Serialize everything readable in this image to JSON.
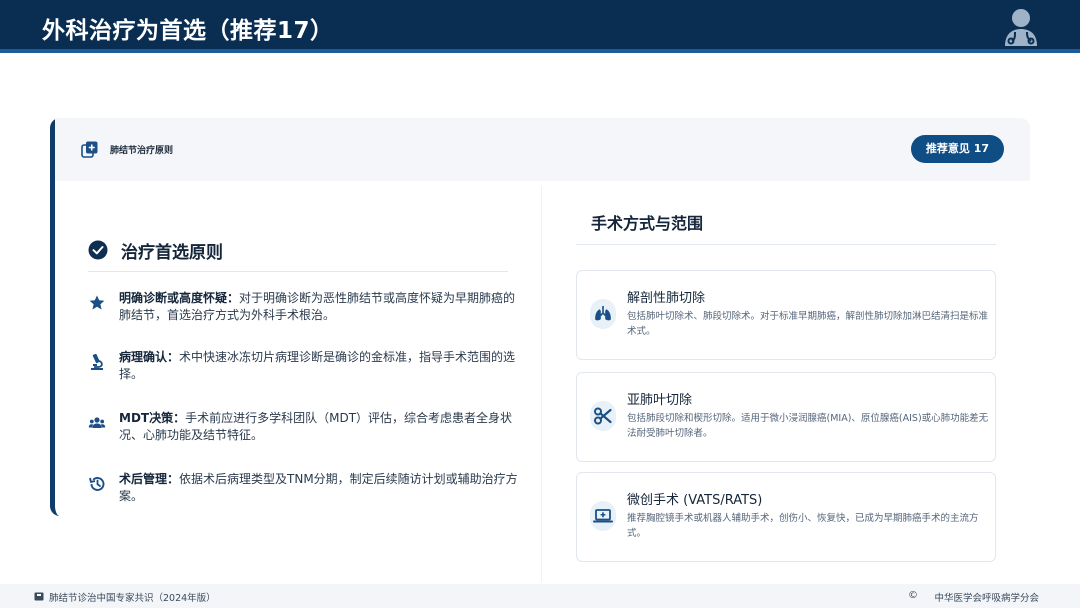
{
  "header": {
    "title": "外科治疗为首选（推荐17）",
    "avatar_icon": "doctor-avatar-icon"
  },
  "card": {
    "label": "肺结节治疗原则",
    "label_icon": "document-add-icon",
    "recommend_button": "推荐意见 17"
  },
  "principles": {
    "title": "治疗首选原则",
    "title_icon": "check-circle-icon",
    "items": [
      {
        "icon": "star-icon",
        "heading": "明确诊断或高度怀疑：",
        "text": "对于明确诊断为恶性肺结节或高度怀疑为早期肺癌的肺结节，首选治疗方式为外科手术根治。"
      },
      {
        "icon": "microscope-icon",
        "heading": "病理确认：",
        "text": "术中快速冰冻切片病理诊断是确诊的金标准，指导手术范围的选择。"
      },
      {
        "icon": "users-icon",
        "heading": "MDT决策：",
        "text": "手术前应进行多学科团队（MDT）评估，综合考虑患者全身状况、心肺功能及结节特征。"
      },
      {
        "icon": "history-icon",
        "heading": "术后管理：",
        "text": "依据术后病理类型及TNM分期，制定后续随访计划或辅助治疗方案。"
      }
    ]
  },
  "surgery": {
    "title": "手术方式与范围",
    "methods": [
      {
        "icon": "lungs-icon",
        "name": "解剖性肺切除",
        "desc": "包括肺叶切除术、肺段切除术。对于标准早期肺癌，解剖性肺切除加淋巴结清扫是标准术式。"
      },
      {
        "icon": "scissors-icon",
        "name": "亚肺叶切除",
        "desc": "包括肺段切除和楔形切除。适用于微小浸润腺癌(MIA)、原位腺癌(AIS)或心肺功能差无法耐受肺叶切除者。"
      },
      {
        "icon": "laptop-medical-icon",
        "name": "微创手术 (VATS/RATS)",
        "desc": "推荐胸腔镜手术或机器人辅助手术，创伤小、恢复快，已成为早期肺癌手术的主流方式。"
      }
    ]
  },
  "footer": {
    "left": "肺结节诊治中国专家共识（2024年版）",
    "copyright_symbol": "©",
    "right": "中华医学会呼吸病学分会"
  },
  "colors": {
    "header_bg": "#0a2e52",
    "accent": "#0f4d85",
    "icon_blue": "#1b4f86"
  }
}
